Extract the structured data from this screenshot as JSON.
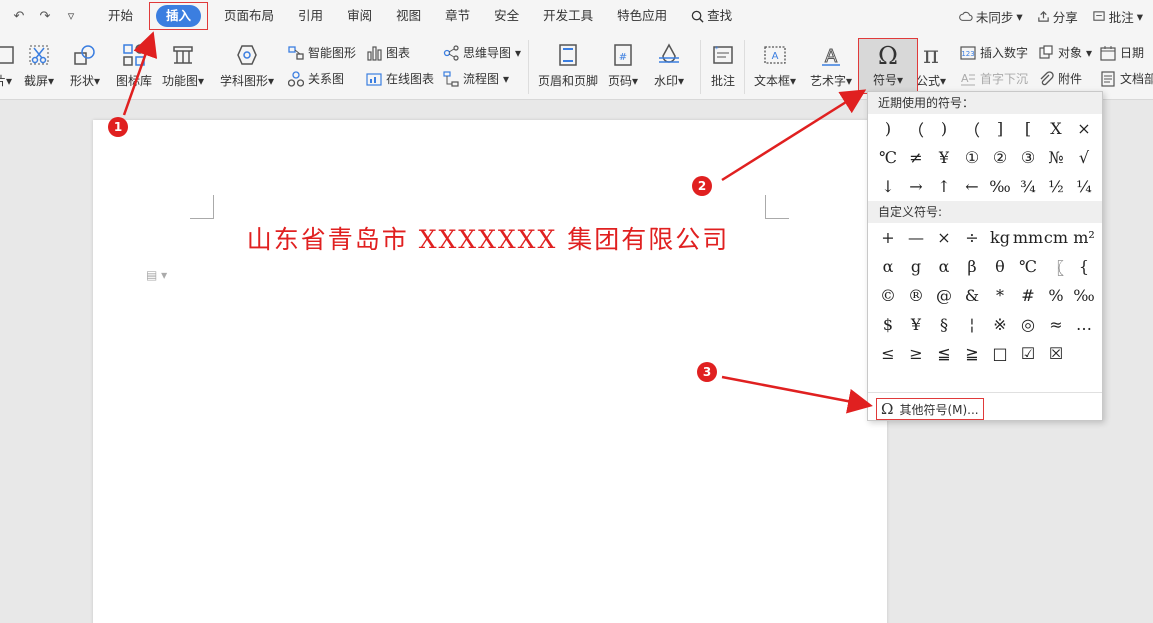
{
  "quick_access": {
    "undo": "↶",
    "redo": "↷",
    "more": "▿"
  },
  "menu": {
    "tabs": [
      "开始",
      "插入",
      "页面布局",
      "引用",
      "审阅",
      "视图",
      "章节",
      "安全",
      "开发工具",
      "特色应用"
    ],
    "active_tab": "插入",
    "search": "查找",
    "right": {
      "sync": "未同步",
      "share": "分享",
      "comment": "批注"
    }
  },
  "ribbon": {
    "screenshot": "截屏",
    "shapes": "形状",
    "icon_library": "图标库",
    "function_chart": "功能图",
    "subject_shapes": "学科图形",
    "smart_shapes": "智能图形",
    "relation_chart": "关系图",
    "chart": "图表",
    "online_chart": "在线图表",
    "mind_map": "思维导图",
    "flow_chart": "流程图",
    "header_footer": "页眉和页脚",
    "page_number": "页码",
    "watermark": "水印",
    "annotation": "批注",
    "textbox": "文本框",
    "art_text": "艺术字",
    "symbol": "符号",
    "formula": "公式",
    "insert_number": "插入数字",
    "object": "对象",
    "date": "日期",
    "drop_cap": "首字下沉",
    "attachment": "附件",
    "doc_part": "文档部"
  },
  "document": {
    "title": "山东省青岛市 XXXXXXX 集团有限公司"
  },
  "symbol_dropdown": {
    "recent_header": "近期使用的符号：",
    "recent": [
      ")",
      "（",
      ")",
      "（",
      "]",
      "[",
      "X",
      "×",
      "℃",
      "≠",
      "¥",
      "①",
      "②",
      "③",
      "№",
      "√",
      "↓",
      "→",
      "↑",
      "←",
      "‰",
      "¾",
      "½",
      "¼"
    ],
    "custom_header": "自定义符号:",
    "custom": [
      "+",
      "—",
      "×",
      "÷",
      "kg",
      "mm",
      "cm",
      "m²",
      "α",
      "g",
      "α",
      "β",
      "θ",
      "℃",
      "〖",
      "{",
      "©",
      "®",
      "@",
      "&",
      "*",
      "#",
      "%",
      "‰",
      "$",
      "¥",
      "§",
      "¦",
      "※",
      "◎",
      "≈",
      "…",
      "≤",
      "≥",
      "≦",
      "≧",
      "□",
      "☑",
      "☒"
    ],
    "other_symbols": "其他符号(M)..."
  },
  "annotations": {
    "step1": "1",
    "step2": "2",
    "step3": "3"
  },
  "colors": {
    "accent": "#3b7ee0",
    "highlight": "#e03a3a",
    "title_red": "#e02020"
  }
}
